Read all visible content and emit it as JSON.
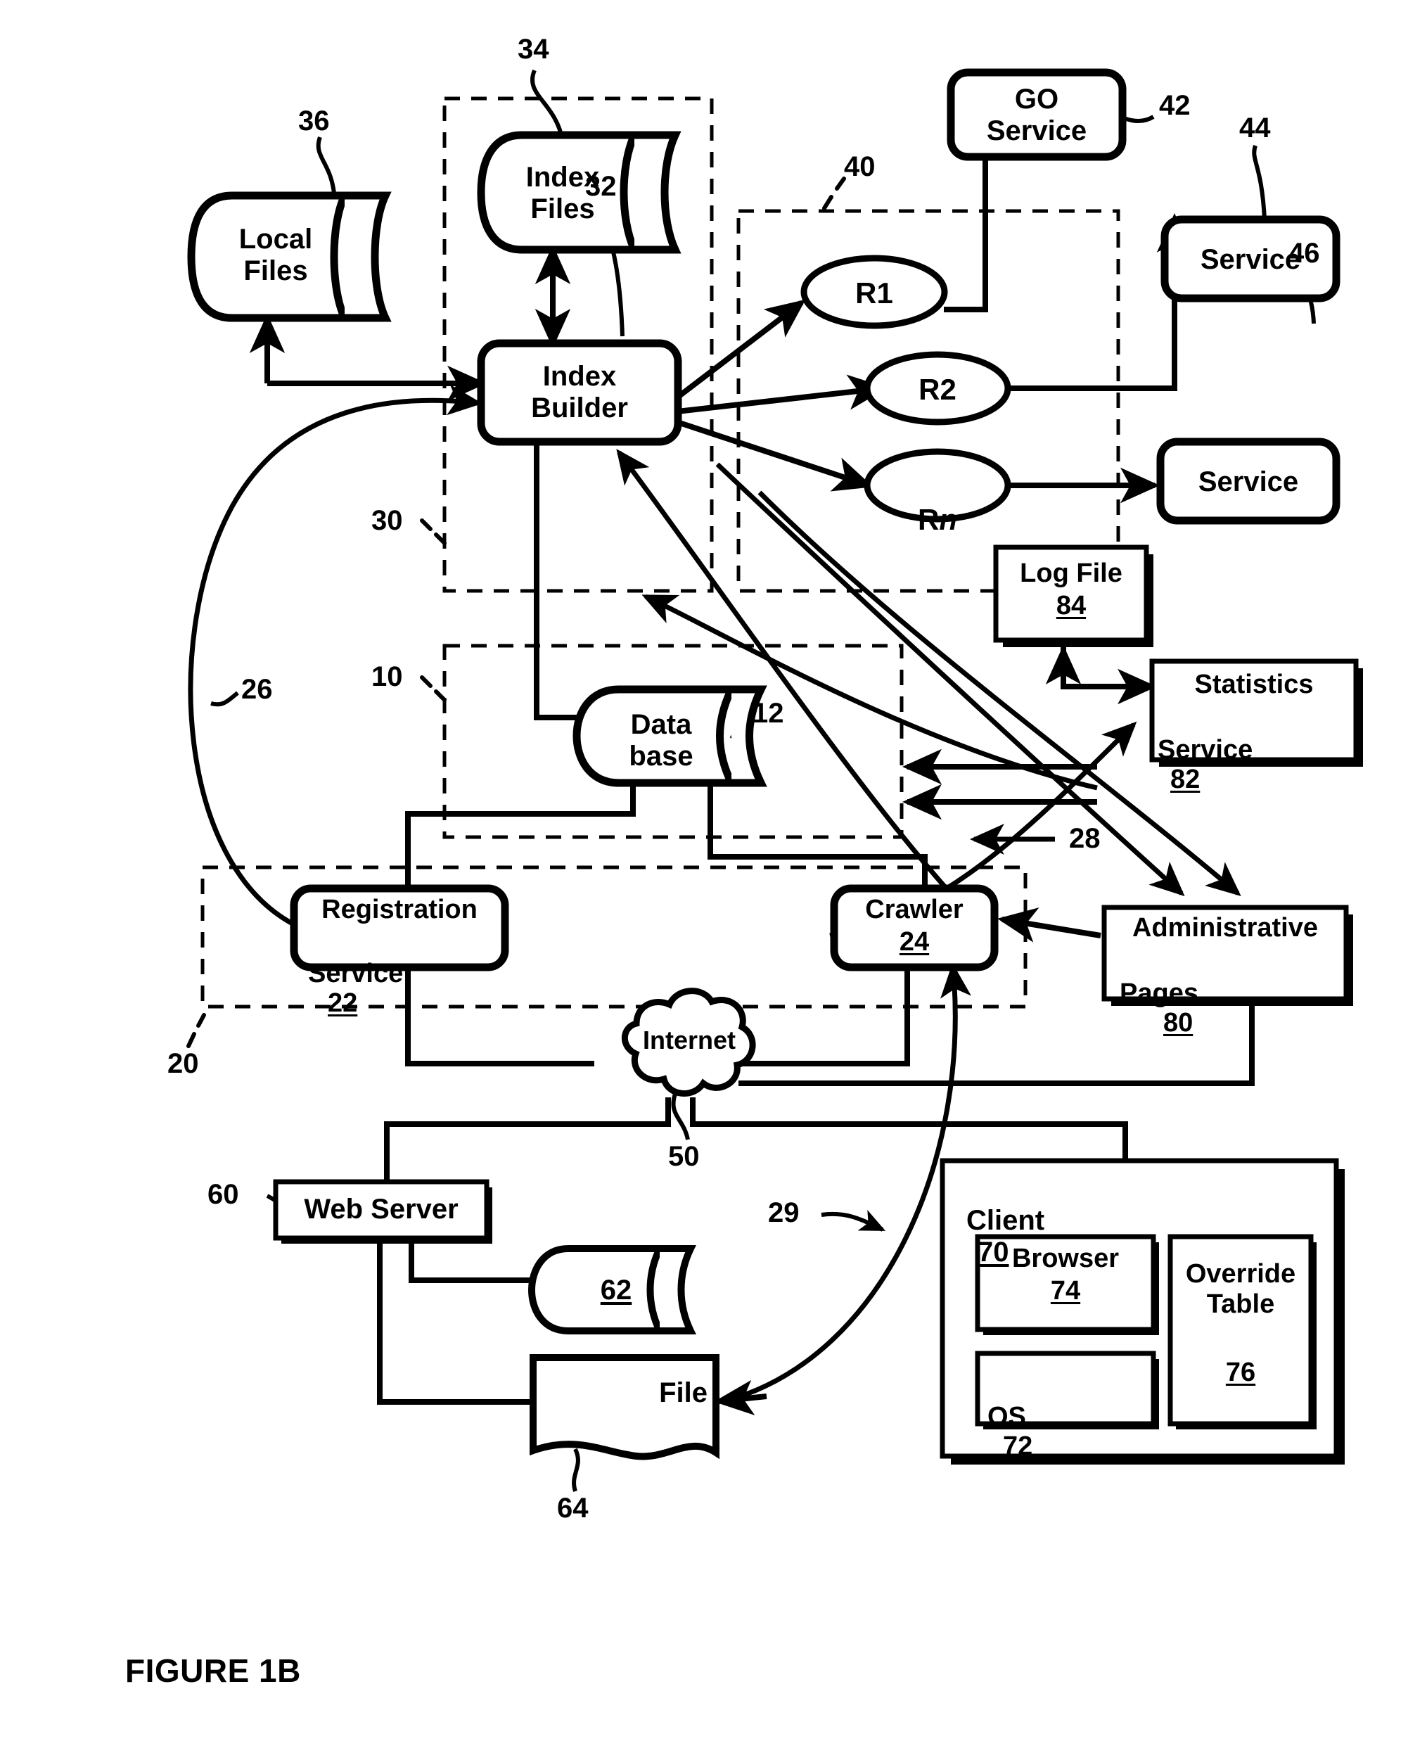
{
  "figure": {
    "caption": "FIGURE 1B",
    "type": "patent-block-diagram"
  },
  "nodes": {
    "local_files": {
      "label": "Local\nFiles",
      "ref": "36"
    },
    "index_files": {
      "label": "Index\nFiles",
      "ref": "34"
    },
    "index_builder": {
      "label": "Index\nBuilder",
      "ref": "32"
    },
    "r1": {
      "label": "R1"
    },
    "r2": {
      "label": "R2"
    },
    "rn": {
      "label_pre": "R",
      "label_ital": "n"
    },
    "go_service": {
      "label": "GO\nService",
      "ref": "42"
    },
    "service_44": {
      "label": "Service",
      "ref": "44"
    },
    "service_46": {
      "label": "Service",
      "ref": "46"
    },
    "log_file": {
      "label": "Log File",
      "ref": "84"
    },
    "statistics": {
      "label": "Statistics",
      "label2": "Service",
      "ref": "82"
    },
    "database": {
      "label": "Data\nbase",
      "ref": "12"
    },
    "registration": {
      "label": "Registration",
      "label2": "Service",
      "ref": "22"
    },
    "crawler": {
      "label": "Crawler",
      "ref": "24"
    },
    "admin_pages": {
      "label": "Administrative",
      "label2": "Pages",
      "ref": "80"
    },
    "internet": {
      "label": "Internet",
      "ref": "50"
    },
    "web_server": {
      "label": "Web Server",
      "ref": "60"
    },
    "web_store": {
      "ref": "62"
    },
    "file": {
      "label": "File",
      "ref": "64"
    },
    "client": {
      "label": "Client",
      "ref": "70"
    },
    "browser": {
      "label": "Browser",
      "ref": "74"
    },
    "os": {
      "label": "OS",
      "ref": "72"
    },
    "override_table": {
      "label": "Override\nTable",
      "ref": "76"
    }
  },
  "group_refs": {
    "indexing_subsystem": "30",
    "results_subsystem": "40",
    "database_subsystem": "10",
    "services_subsystem": "20"
  },
  "flow_refs": {
    "registration_flow": "26",
    "admin_to_crawler": "28",
    "file_to_crawler": "29"
  },
  "colors": {
    "stroke": "#000000",
    "background": "#ffffff"
  }
}
